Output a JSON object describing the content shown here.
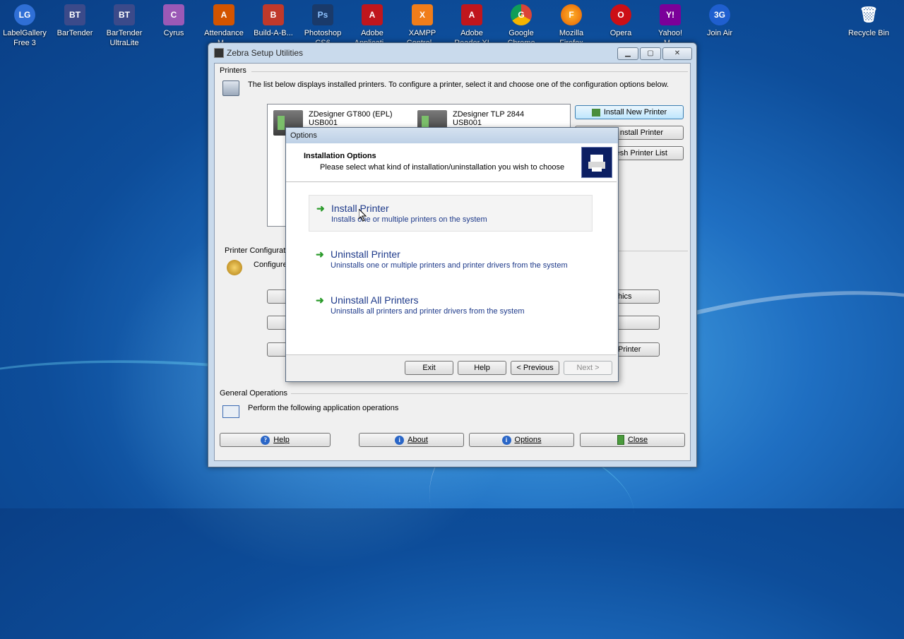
{
  "desktop_icons": [
    {
      "line1": "LabelGallery",
      "line2": "Free 3",
      "color": "#2f6fd6",
      "glyph": "LG"
    },
    {
      "line1": "BarTender",
      "line2": "",
      "color": "#3b4a8a",
      "glyph": "BT"
    },
    {
      "line1": "BarTender",
      "line2": "UltraLite",
      "color": "#3b4a8a",
      "glyph": "BT"
    },
    {
      "line1": "Cyrus",
      "line2": "",
      "color": "#9b59b6",
      "glyph": "C"
    },
    {
      "line1": "Attendance",
      "line2": "M...",
      "color": "#d35400",
      "glyph": "A"
    },
    {
      "line1": "Build-A-B...",
      "line2": "",
      "color": "#c0392b",
      "glyph": "B"
    },
    {
      "line1": "Photoshop",
      "line2": "CS6",
      "color": "#1a3a6a",
      "glyph": "Ps"
    },
    {
      "line1": "Adobe",
      "line2": "Applicati...",
      "color": "#c0161d",
      "glyph": "A"
    },
    {
      "line1": "XAMPP",
      "line2": "Control...",
      "color": "#f07d1a",
      "glyph": "X"
    },
    {
      "line1": "Adobe",
      "line2": "Reader XI",
      "color": "#c0161d",
      "glyph": "A"
    },
    {
      "line1": "Google",
      "line2": "Chrome",
      "color": "#34a853",
      "glyph": "G"
    },
    {
      "line1": "Mozilla",
      "line2": "Firefox",
      "color": "#e66000",
      "glyph": "F"
    },
    {
      "line1": "Opera",
      "line2": "",
      "color": "#cc0f16",
      "glyph": "O"
    },
    {
      "line1": "Yahoo!",
      "line2": "M...",
      "color": "#7b0099",
      "glyph": "Y!"
    },
    {
      "line1": "Join Air",
      "line2": "",
      "color": "#1f5fcf",
      "glyph": "3G"
    },
    {
      "line1": "Recycle Bin",
      "line2": "",
      "color": "#b9c6d3",
      "glyph": "🗑"
    }
  ],
  "window": {
    "title": "Zebra Setup Utilities",
    "printers_label": "Printers",
    "printers_description": "The list below displays installed printers. To configure a printer, select it and choose one of the configuration options below.",
    "printers": [
      {
        "name": "ZDesigner GT800 (EPL)",
        "sub": "USB001"
      },
      {
        "name": "ZDesigner TLP 2844",
        "sub": "USB001"
      }
    ],
    "install_new_printer": "Install New Printer",
    "uninstall_printer_partial": "nstall Printer",
    "refresh_partial": "esh Printer List",
    "printer_config_label": "Printer Configurat",
    "configure_partial": "Configure",
    "graphics_partial": "hics",
    "printer_partial": "Printer",
    "general_operations_label": "General Operations",
    "general_operations_description": "Perform the following application operations",
    "help": "Help",
    "about": "About",
    "options": "Options",
    "close": "Close"
  },
  "dialog": {
    "title": "Options",
    "header_title": "Installation Options",
    "header_subtitle": "Please select what kind of installation/uninstallation you wish to choose",
    "options": [
      {
        "title": "Install Printer",
        "desc": "Installs one or multiple printers on the system"
      },
      {
        "title": "Uninstall Printer",
        "desc": "Uninstalls one or multiple printers and printer drivers from the system"
      },
      {
        "title": "Uninstall All Printers",
        "desc": "Uninstalls all printers and printer drivers from the system"
      }
    ],
    "exit": "Exit",
    "help": "Help",
    "previous": "< Previous",
    "next": "Next >"
  }
}
